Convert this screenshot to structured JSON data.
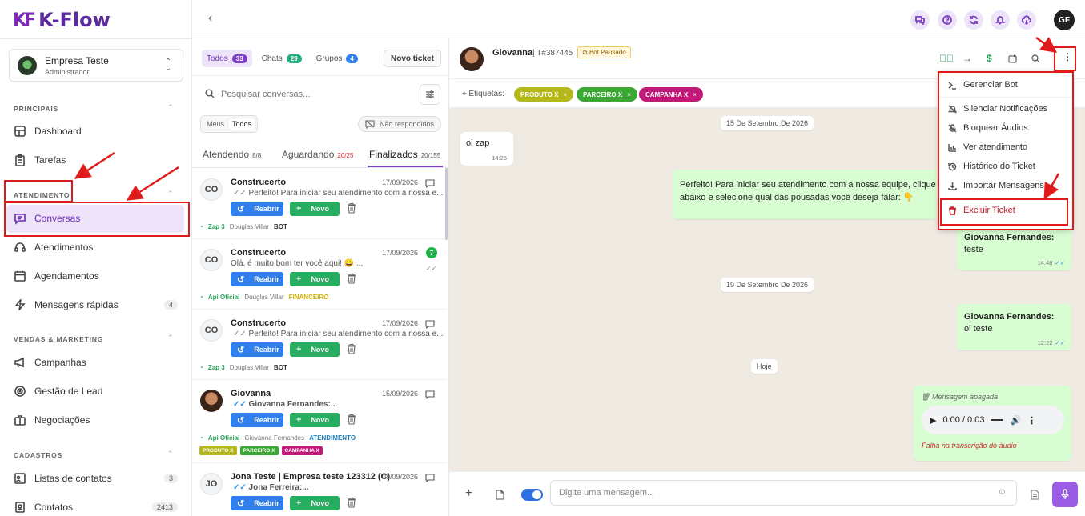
{
  "app": {
    "logo_mark": "KF",
    "logo_name": "K-Flow"
  },
  "company": {
    "name": "Empresa Teste",
    "role": "Administrador"
  },
  "sidebar": {
    "sections": [
      {
        "title": "PRINCIPAIS"
      },
      {
        "title": "ATENDIMENTO"
      },
      {
        "title": "VENDAS & MARKETING"
      },
      {
        "title": "CADASTROS"
      }
    ],
    "items": [
      {
        "label": "Dashboard",
        "icon": "grid-icon"
      },
      {
        "label": "Tarefas",
        "icon": "clipboard-icon"
      },
      {
        "label": "Conversas",
        "icon": "chat-icon"
      },
      {
        "label": "Atendimentos",
        "icon": "headset-icon"
      },
      {
        "label": "Agendamentos",
        "icon": "calendar-icon"
      },
      {
        "label": "Mensagens rápidas",
        "icon": "bolt-icon",
        "badge": "4"
      },
      {
        "label": "Campanhas",
        "icon": "megaphone-icon"
      },
      {
        "label": "Gestão de Lead",
        "icon": "target-icon"
      },
      {
        "label": "Negociações",
        "icon": "briefcase-icon"
      },
      {
        "label": "Listas de contatos",
        "icon": "list-icon",
        "badge": "3"
      },
      {
        "label": "Contatos",
        "icon": "contact-icon",
        "badge": "2413"
      }
    ]
  },
  "list": {
    "tabs": [
      {
        "label": "Todos",
        "count": "33"
      },
      {
        "label": "Chats",
        "count": "29"
      },
      {
        "label": "Grupos",
        "count": "4"
      }
    ],
    "new_ticket": "Novo ticket",
    "search_placeholder": "Pesquisar conversas...",
    "seg": {
      "mine": "Meus",
      "all": "Todos"
    },
    "not_answered": "Não respondidos",
    "status_tabs": [
      {
        "label": "Atendendo",
        "count": "8/8"
      },
      {
        "label": "Aguardando",
        "count": "20/25"
      },
      {
        "label": "Finalizados",
        "count": "20/155"
      }
    ],
    "btn_reopen": "Reabrir",
    "btn_new": "Novo",
    "tickets": [
      {
        "initials": "CO",
        "name": "Construcerto",
        "date": "17/09/2026",
        "msg": "Perfeito! Para iniciar seu atendimento com a nossa e...",
        "conn": "Zap 3",
        "user": "Douglas Villar",
        "queue": "BOT"
      },
      {
        "initials": "CO",
        "name": "Construcerto",
        "date": "17/09/2026",
        "msg": "Olá, é muito bom ter você aqui! 😀 ...",
        "conn": "Api Oficial",
        "user": "Douglas Villar",
        "queue": "FINANCEIRO",
        "unread": "7"
      },
      {
        "initials": "CO",
        "name": "Construcerto",
        "date": "17/09/2026",
        "msg": "Perfeito! Para iniciar seu atendimento com a nossa e...",
        "conn": "Zap 3",
        "user": "Douglas Villar",
        "queue": "BOT"
      },
      {
        "initials": "",
        "name": "Giovanna",
        "date": "15/09/2026",
        "msg": "Giovanna Fernandes:...",
        "conn": "Api Oficial",
        "user": "Giovanna Fernandes",
        "queue": "ATENDIMENTO",
        "tags": [
          "PRODUTO X",
          "PARCEIRO X",
          "CAMPANHA X"
        ]
      },
      {
        "initials": "JO",
        "name": "Jona Teste | Empresa teste 123312 (C)",
        "date": "08/09/2026",
        "msg": "Jona Ferreira:..."
      }
    ]
  },
  "chat": {
    "name": "Giovanna",
    "ticket": "T#387445",
    "bot_status": "Bot Pausado",
    "labels_title": "Etiquetas:",
    "labels": [
      {
        "text": "PRODUTO X",
        "color": "#b5b81a"
      },
      {
        "text": "PARCEIRO X",
        "color": "#3aa832"
      },
      {
        "text": "CAMPANHA X",
        "color": "#c2187a"
      }
    ],
    "date1": "15 De Setembro De 2026",
    "msg1": {
      "text": "oi zap",
      "time": "14:25"
    },
    "msg2": {
      "text": "Perfeito! Para iniciar seu atendimento com a nossa equipe, clique no botão abaixo e selecione qual das pousadas você deseja falar: 👇"
    },
    "msg3": {
      "author": "Giovanna Fernandes:",
      "text": "teste",
      "time": "14:48"
    },
    "date2": "19 De Setembro De 2026",
    "msg4": {
      "author": "Giovanna Fernandes:",
      "text": "oi teste",
      "time": "12:22"
    },
    "date3": "Hoje",
    "msg5": {
      "deleted": "Mensagem apagada",
      "audio_time": "0:00 / 0:03",
      "error": "Falha na transcrição do áudio"
    },
    "composer_placeholder": "Digite uma mensagem..."
  },
  "user_initials": "GF",
  "menu": {
    "items": [
      {
        "label": "Gerenciar Bot",
        "icon": "terminal-icon"
      },
      {
        "label": "Silenciar Notificações",
        "icon": "bell-off-icon"
      },
      {
        "label": "Bloquear Áudios",
        "icon": "mic-off-icon"
      },
      {
        "label": "Ver atendimento",
        "icon": "chart-icon"
      },
      {
        "label": "Histórico do Ticket",
        "icon": "history-icon"
      },
      {
        "label": "Importar Mensagens",
        "icon": "download-icon"
      },
      {
        "label": "Excluir Ticket",
        "icon": "trash-icon"
      }
    ]
  },
  "colors": {
    "accent": "#7b3fc4",
    "annotation": "#e01b1b",
    "chat_bg": "#efeae2",
    "outgoing": "#d9fdd3"
  }
}
